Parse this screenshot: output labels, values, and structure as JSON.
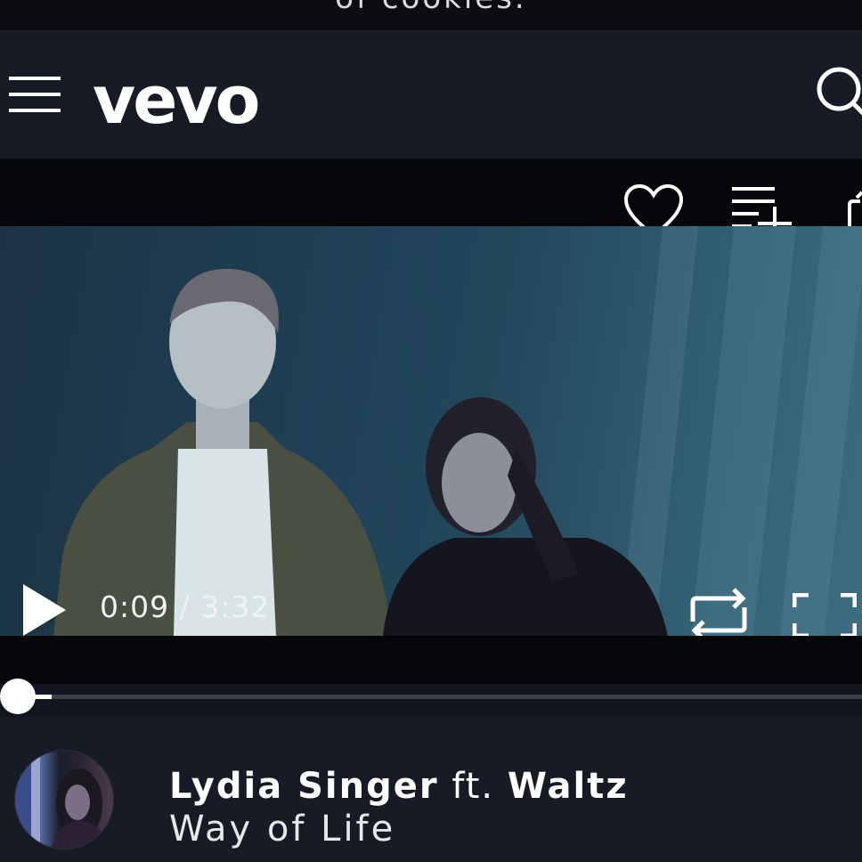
{
  "cookie_banner": {
    "text": "of cookies."
  },
  "header": {
    "logo_text": "vevo",
    "menu_icon": "hamburger-menu-icon",
    "search_icon": "search-icon"
  },
  "player": {
    "actions": [
      "heart-icon",
      "add-to-playlist-icon",
      "share-icon"
    ],
    "current_time": "0:09",
    "separator": " / ",
    "duration": "3:32",
    "progress": 0.042,
    "controls": [
      "play-icon",
      "repeat-icon",
      "fullscreen-icon"
    ]
  },
  "track": {
    "artist": "Lydia Singer",
    "ft": "ft.",
    "featured": "Waltz",
    "title": "Way of Life"
  },
  "colors": {
    "background": "#121620",
    "header": "#161b25",
    "player_bar": "#050609",
    "text": "#ffffff"
  }
}
